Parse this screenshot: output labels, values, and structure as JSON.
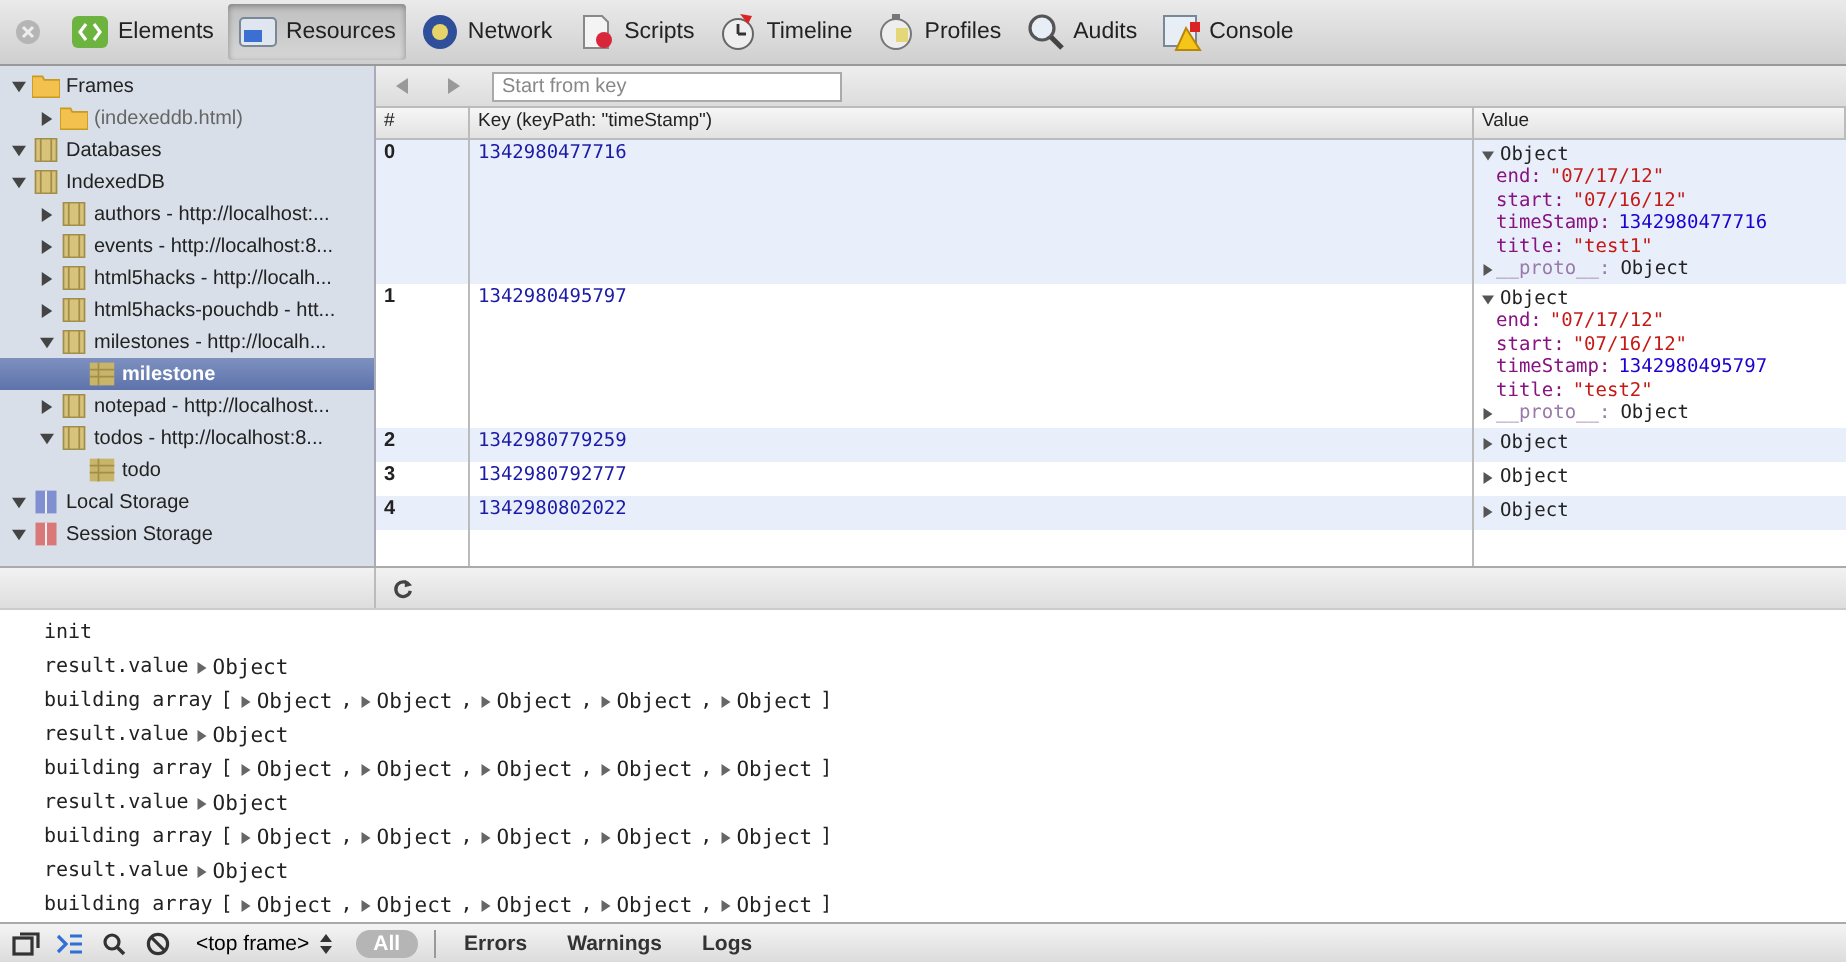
{
  "toolbar": {
    "tabs": [
      {
        "label": "Elements",
        "selected": false
      },
      {
        "label": "Resources",
        "selected": true
      },
      {
        "label": "Network",
        "selected": false
      },
      {
        "label": "Scripts",
        "selected": false
      },
      {
        "label": "Timeline",
        "selected": false
      },
      {
        "label": "Profiles",
        "selected": false
      },
      {
        "label": "Audits",
        "selected": false
      },
      {
        "label": "Console",
        "selected": false
      }
    ]
  },
  "sidebar": {
    "items": [
      {
        "label": "Frames",
        "kind": "folder",
        "expanded": true,
        "selected": false,
        "children": [
          {
            "label": "(indexeddb.html)",
            "kind": "folder",
            "expanded": false,
            "selected": false,
            "dim": true
          }
        ]
      },
      {
        "label": "Databases",
        "kind": "database",
        "expanded": true,
        "selected": false
      },
      {
        "label": "IndexedDB",
        "kind": "database",
        "expanded": true,
        "selected": false,
        "children": [
          {
            "label": "authors - http://localhost:...",
            "kind": "database",
            "expanded": false,
            "selected": false
          },
          {
            "label": "events - http://localhost:8...",
            "kind": "database",
            "expanded": false,
            "selected": false
          },
          {
            "label": "html5hacks - http://localh...",
            "kind": "database",
            "expanded": false,
            "selected": false
          },
          {
            "label": "html5hacks-pouchdb - htt...",
            "kind": "database",
            "expanded": false,
            "selected": false
          },
          {
            "label": "milestones - http://localh...",
            "kind": "database",
            "expanded": true,
            "selected": false,
            "children": [
              {
                "label": "milestone",
                "kind": "store",
                "selected": true
              }
            ]
          },
          {
            "label": "notepad - http://localhost...",
            "kind": "database",
            "expanded": false,
            "selected": false
          },
          {
            "label": "todos - http://localhost:8...",
            "kind": "database",
            "expanded": true,
            "selected": false,
            "children": [
              {
                "label": "todo",
                "kind": "store",
                "selected": false
              }
            ]
          }
        ]
      },
      {
        "label": "Local Storage",
        "kind": "local",
        "expanded": true,
        "selected": false
      },
      {
        "label": "Session Storage",
        "kind": "session",
        "expanded": true,
        "selected": false
      }
    ]
  },
  "grid": {
    "search": {
      "placeholder": "Start from key"
    },
    "columns": [
      "#",
      "Key (keyPath: \"timeStamp\")",
      "Value"
    ],
    "rows": [
      {
        "index": "0",
        "key": "1342980477716",
        "value": {
          "label": "Object",
          "expanded": true,
          "properties": [
            {
              "name": "end:",
              "value": "\"07/17/12\"",
              "kind": "string"
            },
            {
              "name": "start:",
              "value": "\"07/16/12\"",
              "kind": "string"
            },
            {
              "name": "timeStamp:",
              "value": "1342980477716",
              "kind": "number"
            },
            {
              "name": "title:",
              "value": "\"test1\"",
              "kind": "string"
            }
          ],
          "proto": {
            "name": "__proto__:",
            "value": "Object"
          }
        }
      },
      {
        "index": "1",
        "key": "1342980495797",
        "value": {
          "label": "Object",
          "expanded": true,
          "properties": [
            {
              "name": "end:",
              "value": "\"07/17/12\"",
              "kind": "string"
            },
            {
              "name": "start:",
              "value": "\"07/16/12\"",
              "kind": "string"
            },
            {
              "name": "timeStamp:",
              "value": "1342980495797",
              "kind": "number"
            },
            {
              "name": "title:",
              "value": "\"test2\"",
              "kind": "string"
            }
          ],
          "proto": {
            "name": "__proto__:",
            "value": "Object"
          }
        }
      },
      {
        "index": "2",
        "key": "1342980779259",
        "value": {
          "label": "Object",
          "expanded": false
        }
      },
      {
        "index": "3",
        "key": "1342980792777",
        "value": {
          "label": "Object",
          "expanded": false
        }
      },
      {
        "index": "4",
        "key": "1342980802022",
        "value": {
          "label": "Object",
          "expanded": false
        }
      }
    ]
  },
  "console": {
    "lines": [
      {
        "kind": "text",
        "text": "init"
      },
      {
        "kind": "object",
        "text": "result.value",
        "objects": [
          "Object"
        ]
      },
      {
        "kind": "array",
        "text": "building array",
        "open": "[",
        "separator": ",",
        "close": "]",
        "objects": [
          "Object",
          "Object",
          "Object",
          "Object",
          "Object"
        ]
      },
      {
        "kind": "object",
        "text": "result.value",
        "objects": [
          "Object"
        ]
      },
      {
        "kind": "array",
        "text": "building array",
        "open": "[",
        "separator": ",",
        "close": "]",
        "objects": [
          "Object",
          "Object",
          "Object",
          "Object",
          "Object"
        ]
      },
      {
        "kind": "object",
        "text": "result.value",
        "objects": [
          "Object"
        ]
      },
      {
        "kind": "array",
        "text": "building array",
        "open": "[",
        "separator": ",",
        "close": "]",
        "objects": [
          "Object",
          "Object",
          "Object",
          "Object",
          "Object"
        ]
      },
      {
        "kind": "object",
        "text": "result.value",
        "objects": [
          "Object"
        ]
      },
      {
        "kind": "array",
        "text": "building array",
        "open": "[",
        "separator": ",",
        "close": "]",
        "objects": [
          "Object",
          "Object",
          "Object",
          "Object",
          "Object"
        ]
      }
    ]
  },
  "status_bar": {
    "frame_select": "<top frame>",
    "filters": [
      {
        "label": "All",
        "selected": true
      },
      {
        "label": "Errors",
        "selected": false
      },
      {
        "label": "Warnings",
        "selected": false
      },
      {
        "label": "Logs",
        "selected": false
      }
    ]
  }
}
